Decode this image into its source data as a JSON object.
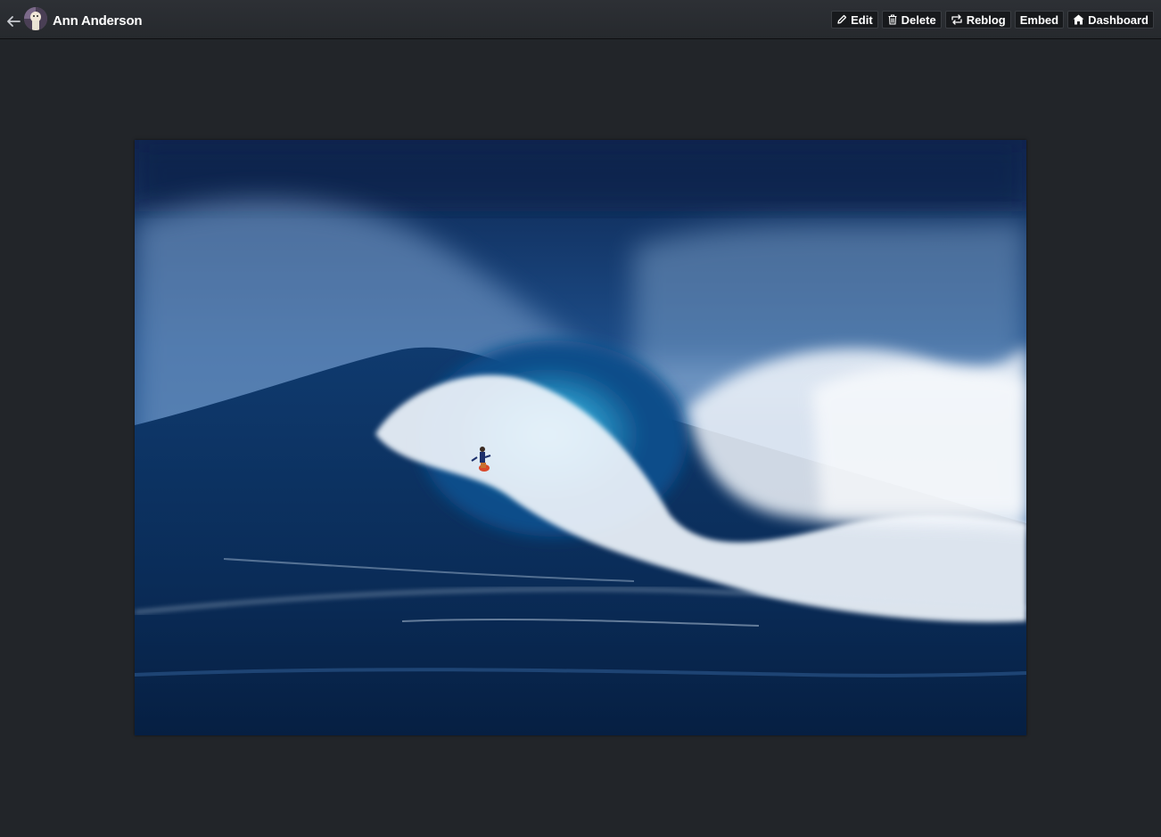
{
  "header": {
    "username": "Ann Anderson",
    "back_icon": "arrow-left-icon",
    "avatar_icon": "avatar"
  },
  "actions": [
    {
      "label": "Edit",
      "icon": "pencil-icon"
    },
    {
      "label": "Delete",
      "icon": "trash-icon"
    },
    {
      "label": "Reblog",
      "icon": "reblog-icon"
    },
    {
      "label": "Embed",
      "icon": ""
    },
    {
      "label": "Dashboard",
      "icon": "home-icon"
    }
  ],
  "photo": {
    "subject": "surfer riding large ocean wave"
  },
  "colors": {
    "background": "#222529",
    "topbar": "#2a2d31",
    "button_bg": "#17191c"
  }
}
